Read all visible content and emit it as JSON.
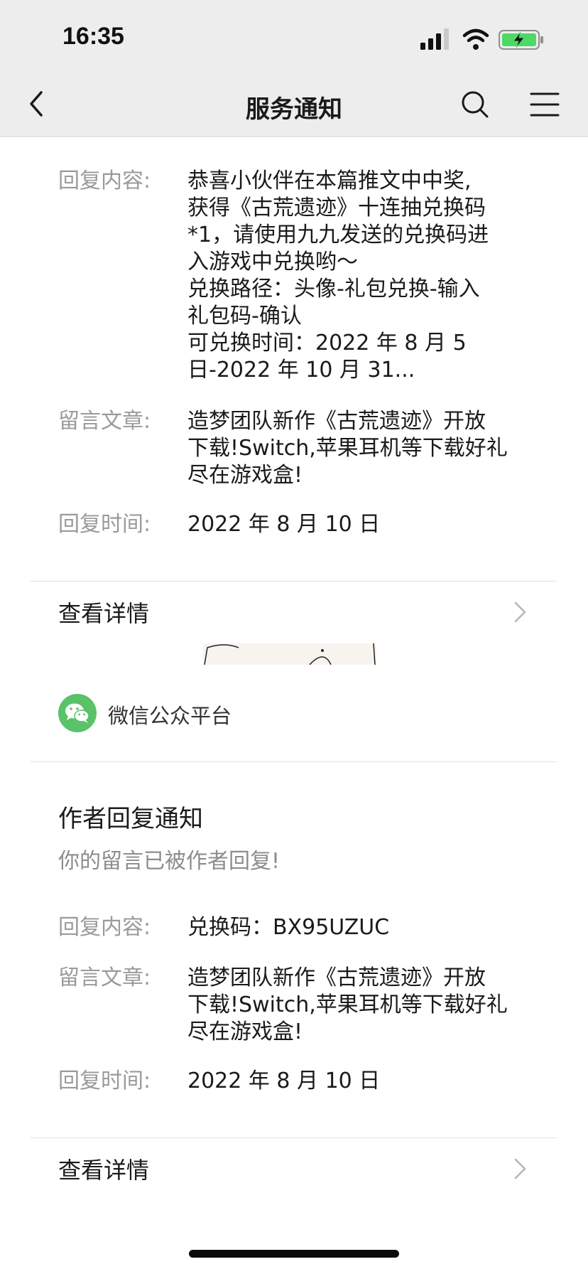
{
  "status_bar": {
    "time": "16:35"
  },
  "nav": {
    "title": "服务通知"
  },
  "notice1": {
    "reply_label": "回复内容:",
    "reply_value": "恭喜小伙伴在本篇推文中中奖,\n获得《古荒遗迹》十连抽兑换码\n*1，请使用九九发送的兑换码进\n入游戏中兑换哟～\n兑换路径：头像-礼包兑换-输入\n礼包码-确认\n可兑换时间：2022 年 8 月 5\n日-2022 年 10 月 31...",
    "article_label": "留言文章:",
    "article_value": "造梦团队新作《古荒遗迹》开放\n下载!Switch,苹果耳机等下载好礼\n尽在游戏盒!",
    "time_label": "回复时间:",
    "time_value": "2022 年 8 月 10 日",
    "detail_label": "查看详情"
  },
  "account": {
    "name": "微信公众平台"
  },
  "notice2": {
    "title": "作者回复通知",
    "subtitle": "你的留言已被作者回复!",
    "reply_label": "回复内容:",
    "reply_value": "兑换码：BX95UZUC",
    "article_label": "留言文章:",
    "article_value": "造梦团队新作《古荒遗迹》开放\n下载!Switch,苹果耳机等下载好礼\n尽在游戏盒!",
    "time_label": "回复时间:",
    "time_value": "2022 年 8 月 10 日",
    "detail_label": "查看详情"
  },
  "colors": {
    "accent": "#5ac269",
    "battery": "#4cd964",
    "nav_bg": "#ededed"
  },
  "icons": [
    "signal-icon",
    "wifi-icon",
    "battery-charging-icon",
    "back-icon",
    "search-icon",
    "menu-icon",
    "chevron-right-icon",
    "wechat-icon"
  ]
}
